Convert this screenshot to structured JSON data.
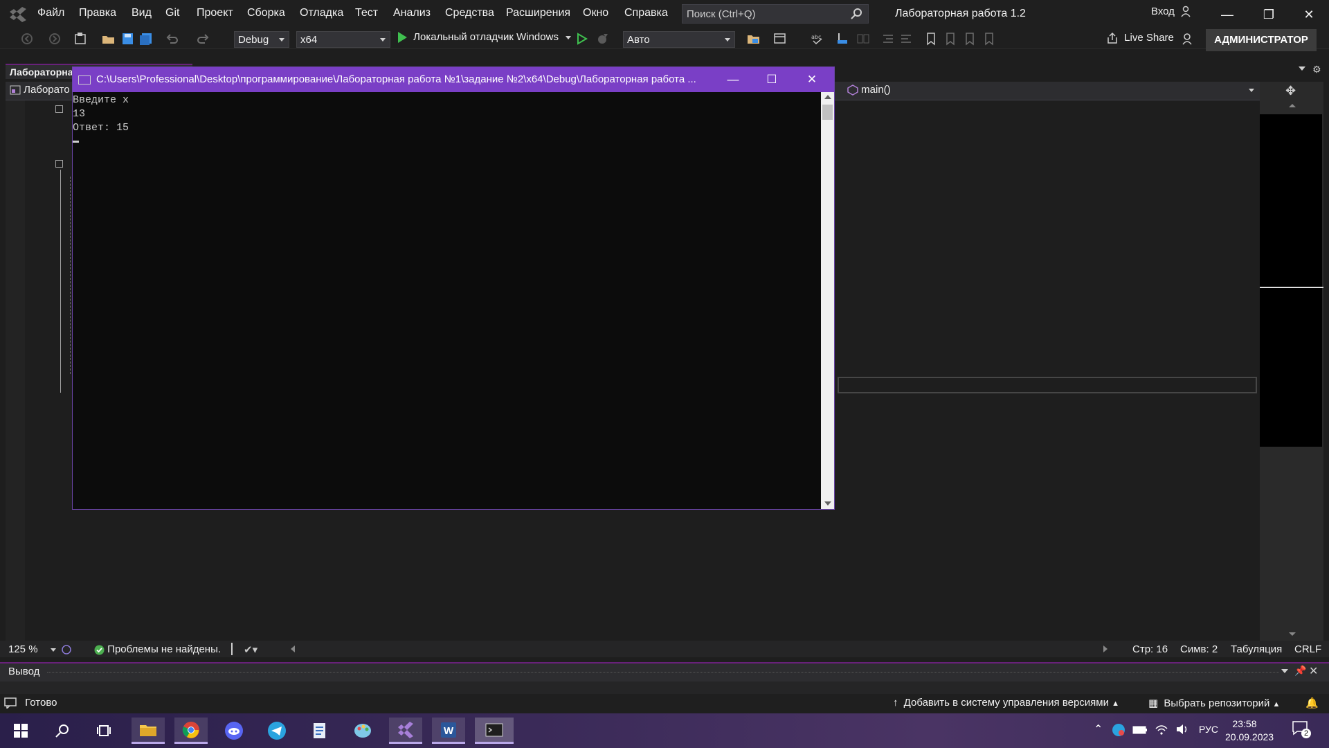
{
  "menubar": {
    "items": [
      "Файл",
      "Правка",
      "Вид",
      "Git",
      "Проект",
      "Сборка",
      "Отладка",
      "Тест",
      "Анализ",
      "Средства",
      "Расширения",
      "Окно",
      "Справка"
    ],
    "search_placeholder": "Поиск (Ctrl+Q)",
    "solution_title": "Лабораторная работа 1.2",
    "signin_label": "Вход"
  },
  "toolbar": {
    "config": "Debug",
    "platform": "x64",
    "run_label": "Локальный отладчик Windows",
    "auto_combo": "Авто",
    "liveshare_label": "Live Share",
    "admin_label": "АДМИНИСТРАТОР"
  },
  "editor": {
    "doc_tab": "Лабораторная работа 1.2",
    "nav_project": "Лаборато",
    "nav_function": "main()"
  },
  "console": {
    "title": "C:\\Users\\Professional\\Desktop\\программирование\\Лабораторная работа №1\\задание №2\\x64\\Debug\\Лабораторная работа ...",
    "lines": [
      "Введите x",
      "13",
      "Ответ: 15"
    ]
  },
  "editor_status": {
    "zoom": "125 %",
    "issues": "Проблемы не найдены.",
    "line": "Стр: 16",
    "col": "Симв: 2",
    "indent": "Табуляция",
    "eol": "CRLF"
  },
  "output": {
    "title": "Вывод"
  },
  "statusbar": {
    "ready": "Готово",
    "vcs": "Добавить в систему управления версиями",
    "repo": "Выбрать репозиторий"
  },
  "taskbar": {
    "apps": [
      "start-icon",
      "search-icon",
      "task-view-icon",
      "file-explorer-icon",
      "chrome-icon",
      "discord-icon",
      "telegram-icon",
      "notepad-icon",
      "paint-icon",
      "visual-studio-icon",
      "word-icon",
      "console-icon"
    ],
    "lang": "РУС",
    "time": "23:58",
    "date": "20.09.2023",
    "notifications": "2"
  },
  "colors": {
    "accent": "#68217a",
    "console_title": "#7a3fc6",
    "ok": "#4caf50"
  }
}
